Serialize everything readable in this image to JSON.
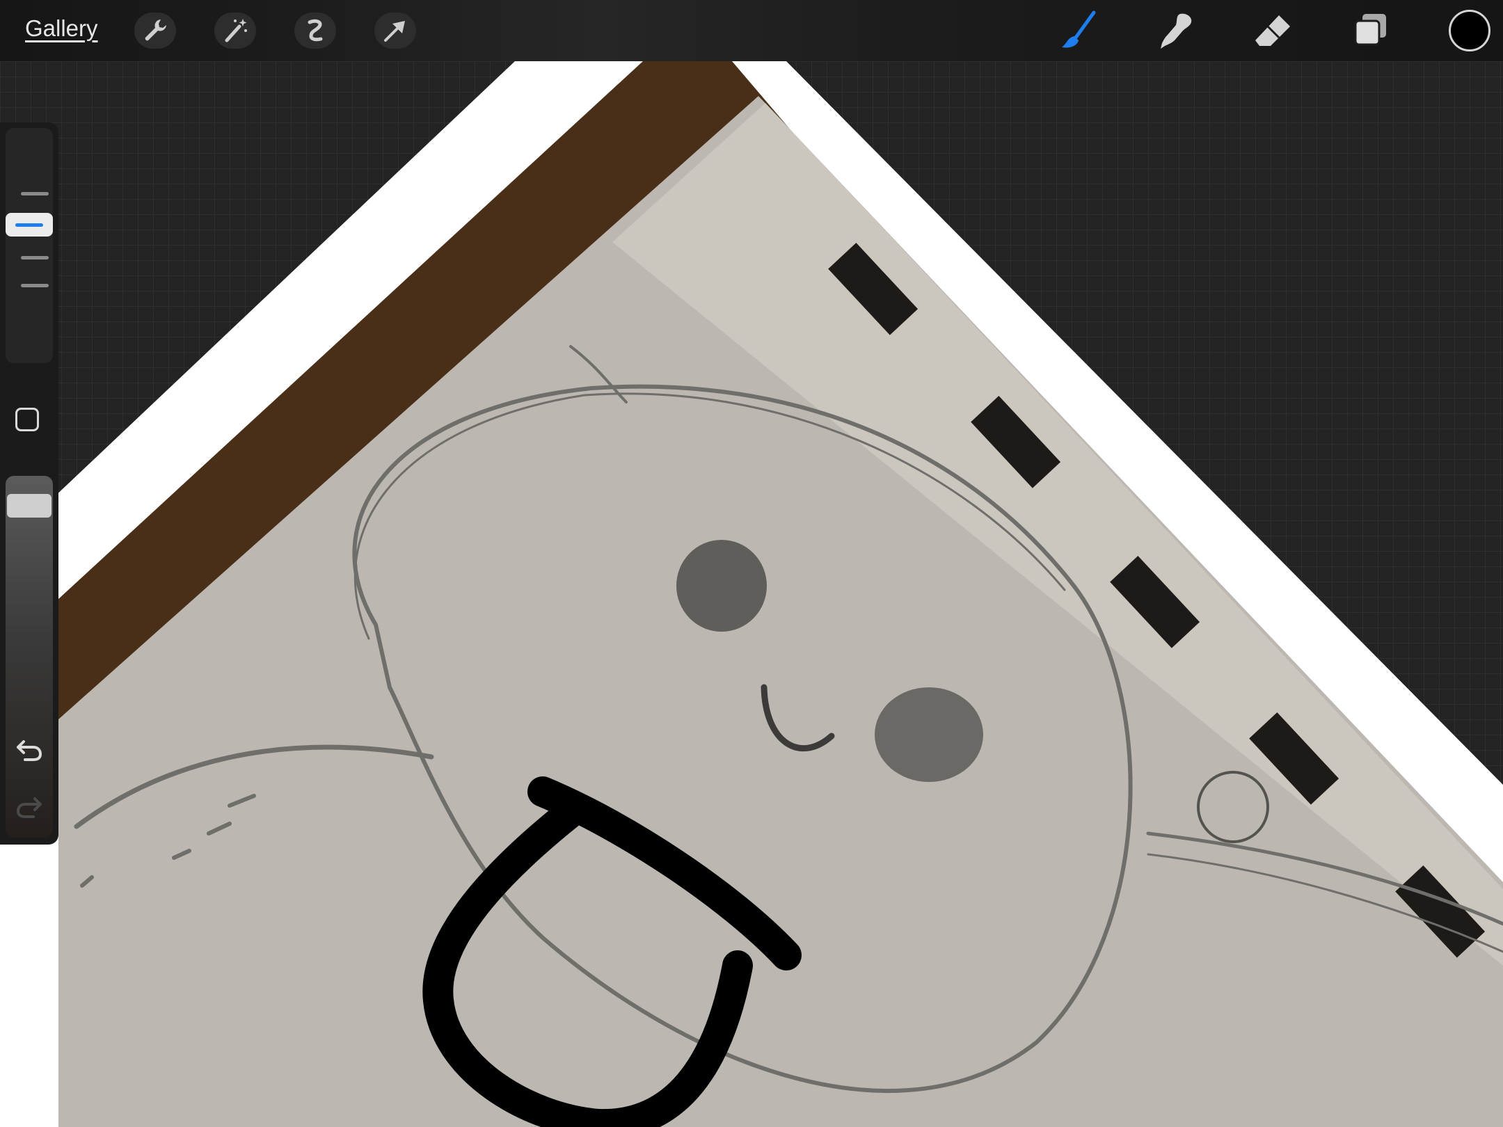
{
  "topbar": {
    "gallery_label": "Gallery",
    "left_tools": [
      "wrench-icon",
      "magic-wand-icon",
      "selection-icon",
      "transform-arrow-icon"
    ],
    "right_tools": [
      "brush-icon",
      "smudge-icon",
      "eraser-icon",
      "layers-icon"
    ],
    "active_tool": "brush",
    "accent_color": "#1e7ef0",
    "current_color": "#000000"
  },
  "sidebar": {
    "brush_size_level": 0.4,
    "brush_opacity_level": 0.95,
    "modify_button": "square-icon",
    "undo": "undo-icon",
    "redo": "redo-icon"
  }
}
